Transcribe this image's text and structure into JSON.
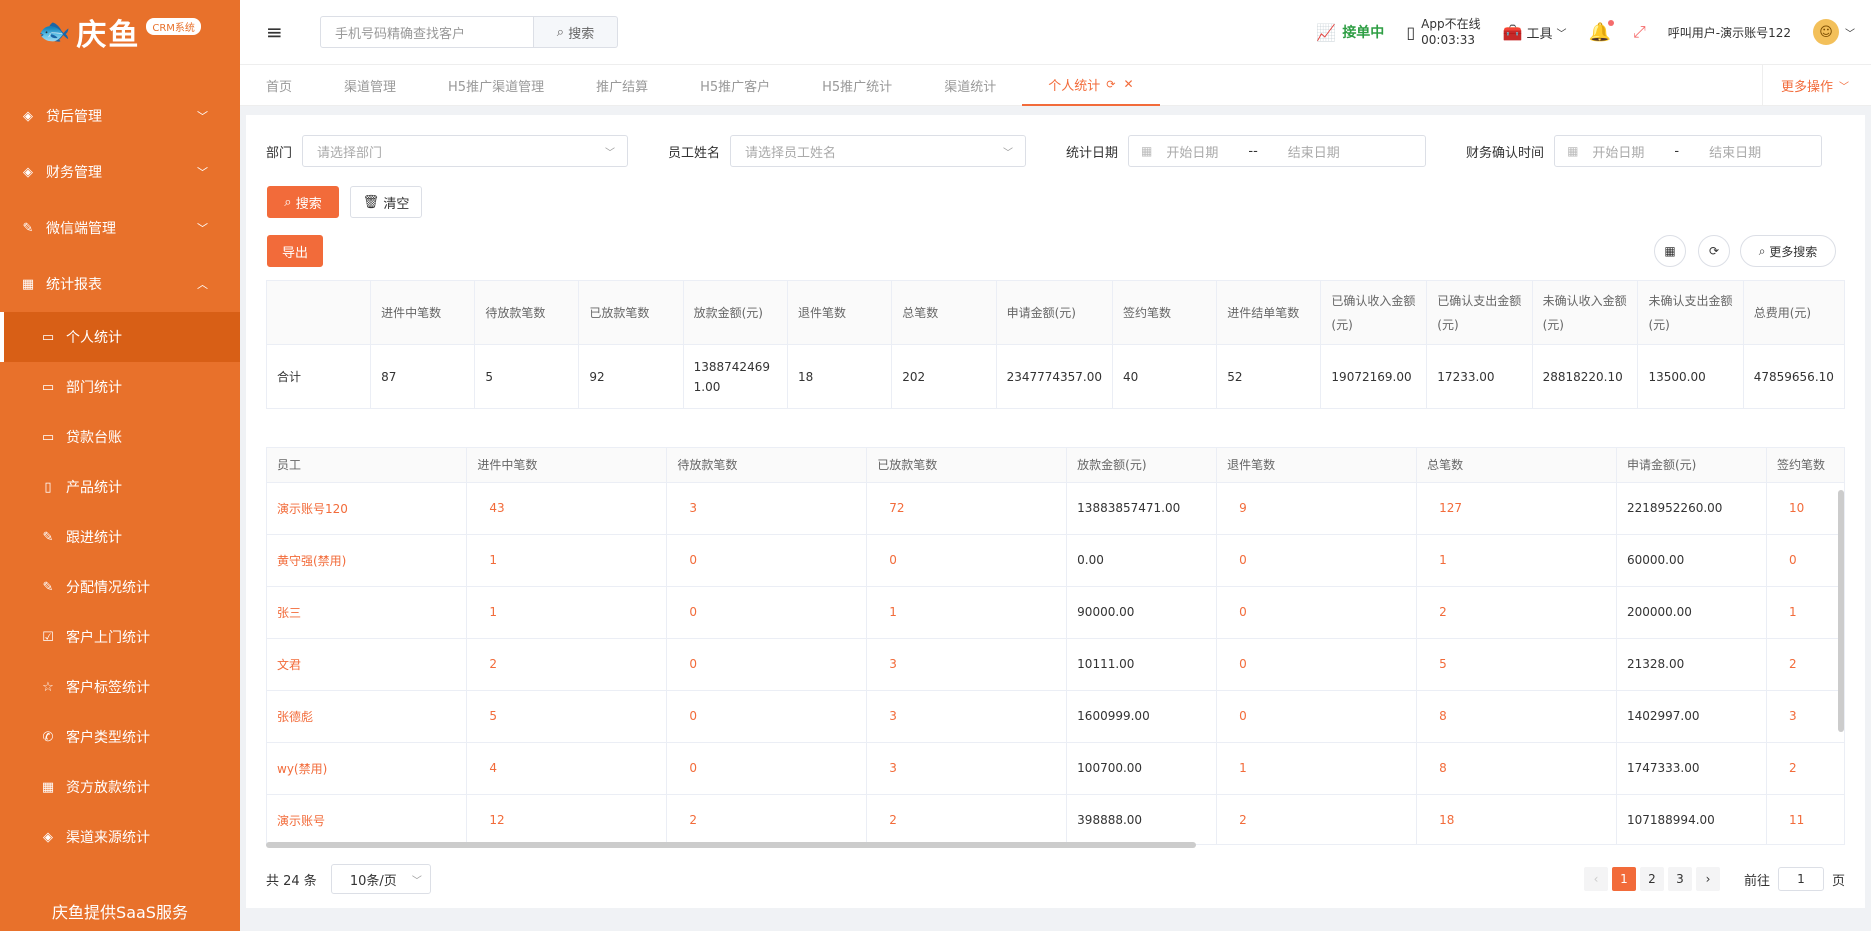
{
  "app": {
    "logo_text": "庆鱼",
    "badge": "CRM系统",
    "saas_text": "庆鱼提供SaaS服务"
  },
  "sidebar": {
    "groups": [
      {
        "label": "贷后管理",
        "icon": "tag-icon"
      },
      {
        "label": "财务管理",
        "icon": "tag-icon"
      },
      {
        "label": "微信端管理",
        "icon": "edit-icon"
      },
      {
        "label": "统计报表",
        "icon": "table-icon"
      }
    ],
    "items": [
      {
        "label": "个人统计",
        "icon": "monitor-icon"
      },
      {
        "label": "部门统计",
        "icon": "monitor-icon"
      },
      {
        "label": "贷款台账",
        "icon": "monitor-icon"
      },
      {
        "label": "产品统计",
        "icon": "document-icon"
      },
      {
        "label": "跟进统计",
        "icon": "edit-icon"
      },
      {
        "label": "分配情况统计",
        "icon": "edit-icon"
      },
      {
        "label": "客户上门统计",
        "icon": "checkbox-icon"
      },
      {
        "label": "客户标签统计",
        "icon": "star-icon"
      },
      {
        "label": "客户类型统计",
        "icon": "phone-icon"
      },
      {
        "label": "资方放款统计",
        "icon": "grid-icon"
      },
      {
        "label": "渠道来源统计",
        "icon": "tag-icon"
      }
    ]
  },
  "header": {
    "search_placeholder": "手机号码精确查找客户",
    "search_btn": "搜索",
    "receiving": "接单中",
    "app_status": "App不在线",
    "app_timer": "00:03:33",
    "tools": "工具",
    "user": "呼叫用户-演示账号122"
  },
  "tabs": [
    "首页",
    "渠道管理",
    "H5推广渠道管理",
    "推广结算",
    "H5推广客户",
    "H5推广统计",
    "渠道统计",
    "个人统计"
  ],
  "more_ops": "更多操作",
  "filter": {
    "dept_label": "部门",
    "dept_placeholder": "请选择部门",
    "emp_label": "员工姓名",
    "emp_placeholder": "请选择员工姓名",
    "stat_label": "统计日期",
    "start": "开始日期",
    "end": "结束日期",
    "sep1": "--",
    "fin_label": "财务确认时间",
    "sep2": "-"
  },
  "buttons": {
    "search": "搜索",
    "clear": "清空",
    "export": "导出",
    "more_search": "更多搜索"
  },
  "summary": {
    "headers": [
      "",
      "进件中笔数",
      "待放款笔数",
      "已放款笔数",
      "放款金额(元)",
      "退件笔数",
      "总笔数",
      "申请金额(元)",
      "签约笔数",
      "进件结单笔数",
      "已确认收入金额(元)",
      "已确认支出金额(元)",
      "未确认收入金额(元)",
      "未确认支出金额(元)",
      "总费用(元)"
    ],
    "row": [
      "合计",
      "87",
      "5",
      "92",
      "13887424691.00",
      "18",
      "202",
      "2347774357.00",
      "40",
      "52",
      "19072169.00",
      "17233.00",
      "28818220.10",
      "13500.00",
      "47859656.10"
    ]
  },
  "table": {
    "headers": [
      "员工",
      "进件中笔数",
      "待放款笔数",
      "已放款笔数",
      "放款金额(元)",
      "退件笔数",
      "总笔数",
      "申请金额(元)",
      "签约笔数"
    ],
    "rows": [
      [
        "演示账号120",
        "43",
        "3",
        "72",
        "13883857471.00",
        "9",
        "127",
        "2218952260.00",
        "10"
      ],
      [
        "黄守强(禁用)",
        "1",
        "0",
        "0",
        "0.00",
        "0",
        "1",
        "60000.00",
        "0"
      ],
      [
        "张三",
        "1",
        "0",
        "1",
        "90000.00",
        "0",
        "2",
        "200000.00",
        "1"
      ],
      [
        "文君",
        "2",
        "0",
        "3",
        "10111.00",
        "0",
        "5",
        "21328.00",
        "2"
      ],
      [
        "张德彪",
        "5",
        "0",
        "3",
        "1600999.00",
        "0",
        "8",
        "1402997.00",
        "3"
      ],
      [
        "wy(禁用)",
        "4",
        "0",
        "3",
        "100700.00",
        "1",
        "8",
        "1747333.00",
        "2"
      ],
      [
        "演示账号",
        "12",
        "2",
        "2",
        "398888.00",
        "2",
        "18",
        "107188994.00",
        "11"
      ]
    ]
  },
  "footer": {
    "total": "共 24 条",
    "page_size": "10条/页",
    "pages": [
      "1",
      "2",
      "3"
    ],
    "goto_label": "前往",
    "goto_value": "1",
    "goto_unit": "页"
  }
}
